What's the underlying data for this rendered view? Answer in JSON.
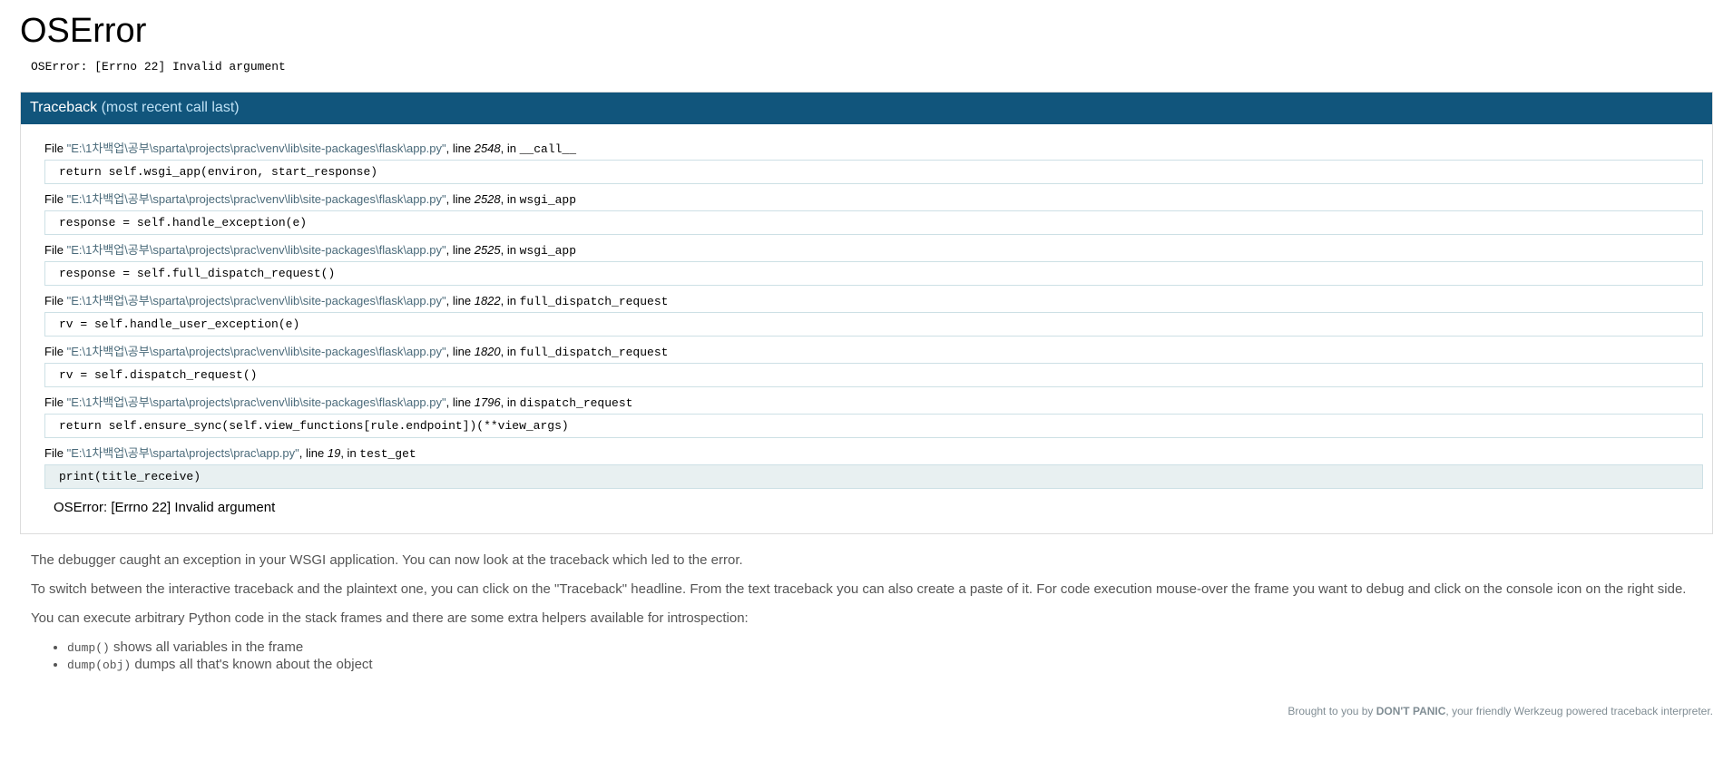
{
  "title": "OSError",
  "error_message": "OSError: [Errno 22] Invalid argument",
  "traceback_header": {
    "label": "Traceback",
    "sub": "(most recent call last)"
  },
  "frames": [
    {
      "file": "\"E:\\1차백업\\공부\\sparta\\projects\\prac\\venv\\lib\\site-packages\\flask\\app.py\"",
      "line": "2548",
      "func": "__call__",
      "source": "return self.wsgi_app(environ, start_response)"
    },
    {
      "file": "\"E:\\1차백업\\공부\\sparta\\projects\\prac\\venv\\lib\\site-packages\\flask\\app.py\"",
      "line": "2528",
      "func": "wsgi_app",
      "source": "response = self.handle_exception(e)"
    },
    {
      "file": "\"E:\\1차백업\\공부\\sparta\\projects\\prac\\venv\\lib\\site-packages\\flask\\app.py\"",
      "line": "2525",
      "func": "wsgi_app",
      "source": "response = self.full_dispatch_request()"
    },
    {
      "file": "\"E:\\1차백업\\공부\\sparta\\projects\\prac\\venv\\lib\\site-packages\\flask\\app.py\"",
      "line": "1822",
      "func": "full_dispatch_request",
      "source": "rv = self.handle_user_exception(e)"
    },
    {
      "file": "\"E:\\1차백업\\공부\\sparta\\projects\\prac\\venv\\lib\\site-packages\\flask\\app.py\"",
      "line": "1820",
      "func": "full_dispatch_request",
      "source": "rv = self.dispatch_request()"
    },
    {
      "file": "\"E:\\1차백업\\공부\\sparta\\projects\\prac\\venv\\lib\\site-packages\\flask\\app.py\"",
      "line": "1796",
      "func": "dispatch_request",
      "source": "return self.ensure_sync(self.view_functions[rule.endpoint])(**view_args)"
    },
    {
      "file": "\"E:\\1차백업\\공부\\sparta\\projects\\prac\\app.py\"",
      "line": "19",
      "func": "test_get",
      "source": "print(title_receive)"
    }
  ],
  "frame_words": {
    "file": "File",
    "line": ", line",
    "in": ", in"
  },
  "tb_error": "OSError: [Errno 22] Invalid argument",
  "explanation": {
    "p1": "The debugger caught an exception in your WSGI application. You can now look at the traceback which led to the error.",
    "p2": "To switch between the interactive traceback and the plaintext one, you can click on the \"Traceback\" headline. From the text traceback you can also create a paste of it. For code execution mouse-over the frame you want to debug and click on the console icon on the right side.",
    "p3": "You can execute arbitrary Python code in the stack frames and there are some extra helpers available for introspection:",
    "helpers": [
      {
        "code": "dump()",
        "text": " shows all variables in the frame"
      },
      {
        "code": "dump(obj)",
        "text": " dumps all that's known about the object"
      }
    ]
  },
  "footer": {
    "prefix": "Brought to you by ",
    "brand": "DON'T PANIC",
    "suffix": ", your friendly Werkzeug powered traceback interpreter."
  }
}
